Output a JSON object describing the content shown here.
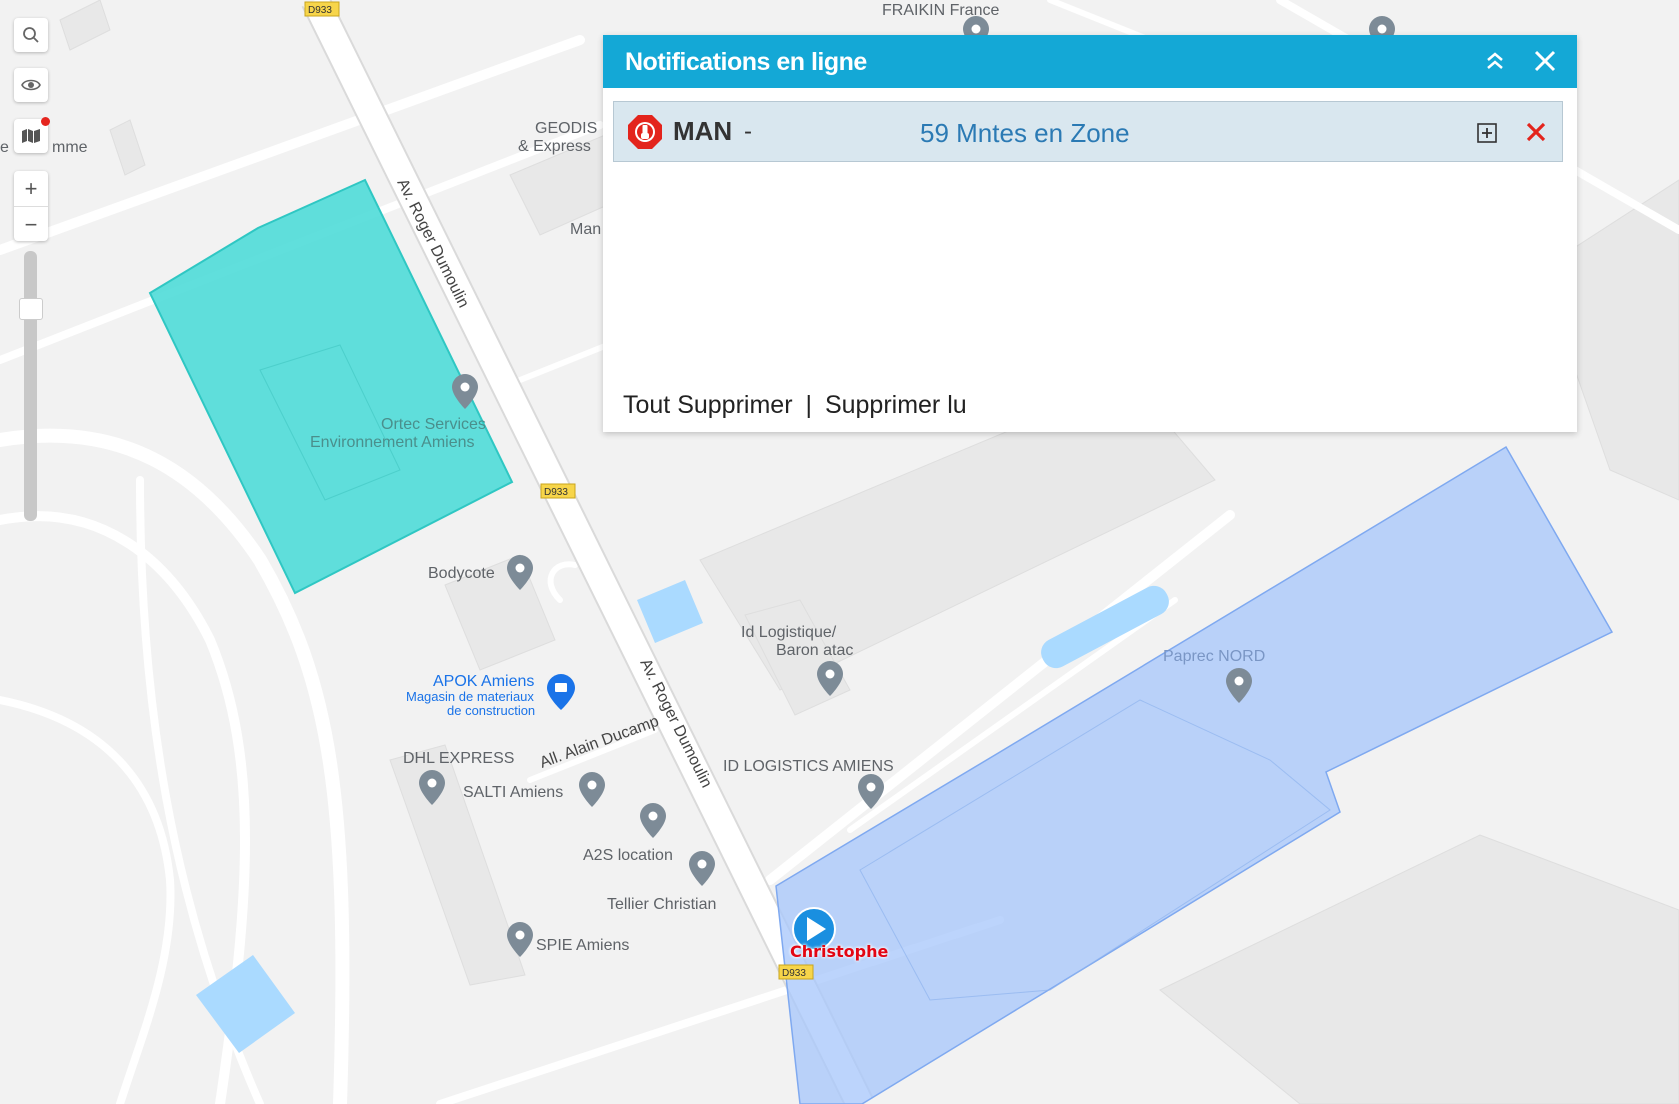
{
  "map": {
    "road_shield": "D933",
    "road_name": "Av. Roger Dumoulin",
    "street_alain": "All. Alain Ducamp",
    "places": {
      "fraikin": "FRAIKIN France",
      "geodis_1": "GEODIS",
      "geodis_2": "& Express",
      "man_partial": "Man",
      "somme_partial": "e",
      "somme_partial_2": "mme",
      "ortec_1": "Ortec Services",
      "ortec_2": "Environnement Amiens",
      "bodycote": "Bodycote",
      "id_logistique_1": "Id Logistique/",
      "id_logistique_2": "Baron atac",
      "paprec": "Paprec NORD",
      "apok": "APOK Amiens",
      "apok_sub_1": "Magasin de materiaux",
      "apok_sub_2": "de construction",
      "dhl": "DHL EXPRESS",
      "salti": "SALTI Amiens",
      "id_logistics": "ID LOGISTICS AMIENS",
      "a2s": "A2S location",
      "tellier": "Tellier Christian",
      "spie": "SPIE Amiens"
    },
    "driver_name": "Christophe",
    "colors": {
      "zone_teal": "#4fdbd8",
      "zone_blue": "#a9c8fb",
      "water": "#aadaff",
      "road": "#ffffff"
    }
  },
  "controls": {
    "search_icon": "search-icon",
    "visibility_icon": "eye-icon",
    "layers_icon": "map-icon",
    "zoom_in": "+",
    "zoom_out": "−"
  },
  "notifications": {
    "title": "Notifications en ligne",
    "collapse_icon": "double-chevron-up-icon",
    "close_icon": "close-icon",
    "items": [
      {
        "icon": "alert-stop-icon",
        "vehicle": "MAN",
        "separator": "-",
        "message": "59 Mntes en Zone"
      }
    ],
    "delete_all": "Tout Supprimer",
    "link_separator": "|",
    "delete_read": "Supprimer lu"
  }
}
